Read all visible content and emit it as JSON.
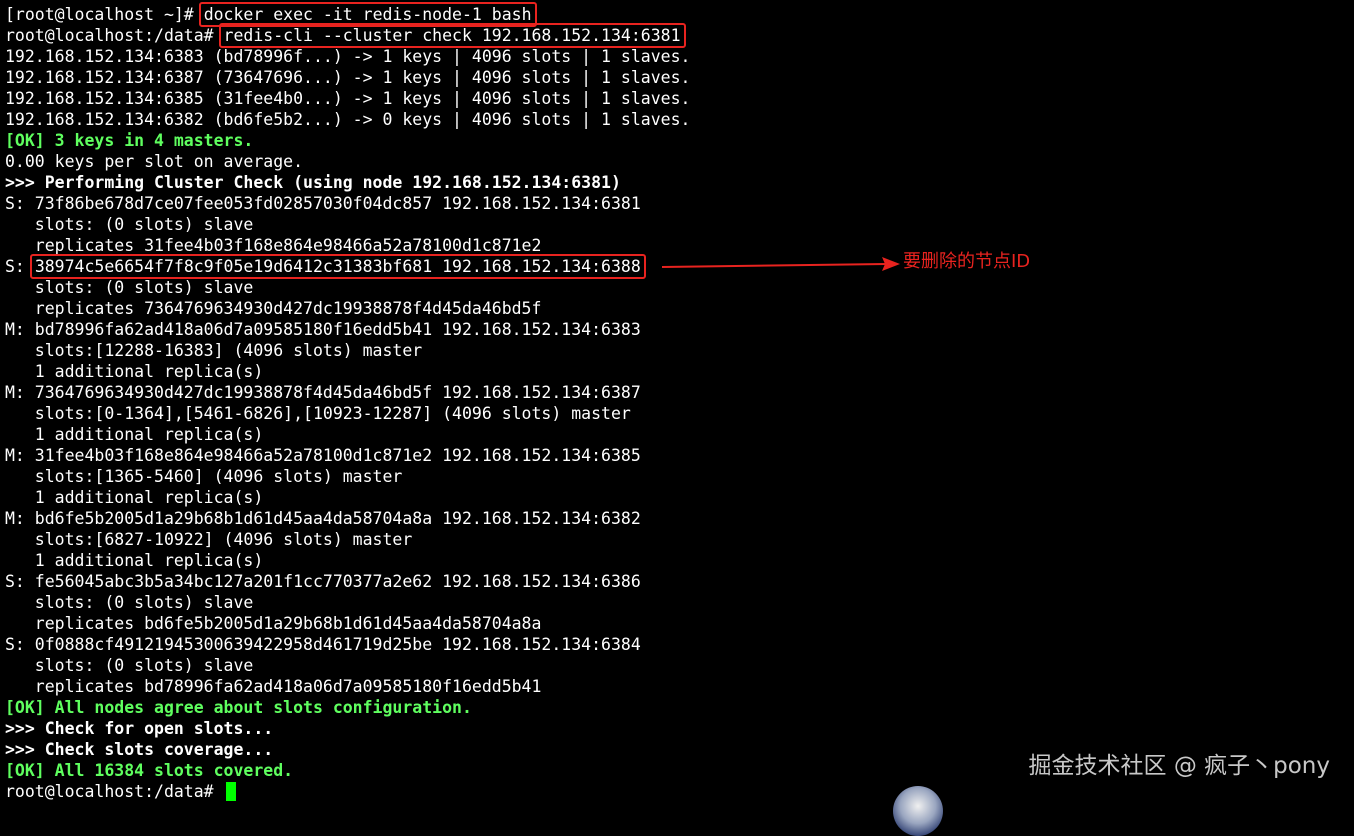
{
  "terminal": {
    "lines": [
      {
        "prompt": "[root@localhost ~]# ",
        "command": "docker exec -it redis-node-1 bash"
      },
      {
        "prompt": "root@localhost:/data# ",
        "command": "redis-cli --cluster check 192.168.152.134:6381"
      },
      {
        "text": "192.168.152.134:6383 (bd78996f...) -> 1 keys | 4096 slots | 1 slaves."
      },
      {
        "text": "192.168.152.134:6387 (73647696...) -> 1 keys | 4096 slots | 1 slaves."
      },
      {
        "text": "192.168.152.134:6385 (31fee4b0...) -> 1 keys | 4096 slots | 1 slaves."
      },
      {
        "text": "192.168.152.134:6382 (bd6fe5b2...) -> 0 keys | 4096 slots | 1 slaves."
      },
      {
        "text": "[OK] 3 keys in 4 masters."
      },
      {
        "text": "0.00 keys per slot on average."
      },
      {
        "text": ">>> Performing Cluster Check (using node 192.168.152.134:6381)"
      },
      {
        "text": "S: 73f86be678d7ce07fee053fd02857030f04dc857 192.168.152.134:6381"
      },
      {
        "text": "   slots: (0 slots) slave"
      },
      {
        "text": "   replicates 31fee4b03f168e864e98466a52a78100d1c871e2"
      },
      {
        "prefix": "S: ",
        "highlight": "38974c5e6654f7f8c9f05e19d6412c31383bf681 192.168.152.134:6388"
      },
      {
        "text": "   slots: (0 slots) slave"
      },
      {
        "text": "   replicates 7364769634930d427dc19938878f4d45da46bd5f"
      },
      {
        "text": "M: bd78996fa62ad418a06d7a09585180f16edd5b41 192.168.152.134:6383"
      },
      {
        "text": "   slots:[12288-16383] (4096 slots) master"
      },
      {
        "text": "   1 additional replica(s)"
      },
      {
        "text": "M: 7364769634930d427dc19938878f4d45da46bd5f 192.168.152.134:6387"
      },
      {
        "text": "   slots:[0-1364],[5461-6826],[10923-12287] (4096 slots) master"
      },
      {
        "text": "   1 additional replica(s)"
      },
      {
        "text": "M: 31fee4b03f168e864e98466a52a78100d1c871e2 192.168.152.134:6385"
      },
      {
        "text": "   slots:[1365-5460] (4096 slots) master"
      },
      {
        "text": "   1 additional replica(s)"
      },
      {
        "text": "M: bd6fe5b2005d1a29b68b1d61d45aa4da58704a8a 192.168.152.134:6382"
      },
      {
        "text": "   slots:[6827-10922] (4096 slots) master"
      },
      {
        "text": "   1 additional replica(s)"
      },
      {
        "text": "S: fe56045abc3b5a34bc127a201f1cc770377a2e62 192.168.152.134:6386"
      },
      {
        "text": "   slots: (0 slots) slave"
      },
      {
        "text": "   replicates bd6fe5b2005d1a29b68b1d61d45aa4da58704a8a"
      },
      {
        "text": "S: 0f0888cf49121945300639422958d461719d25be 192.168.152.134:6384"
      },
      {
        "text": "   slots: (0 slots) slave"
      },
      {
        "text": "   replicates bd78996fa62ad418a06d7a09585180f16edd5b41"
      },
      {
        "text": "[OK] All nodes agree about slots configuration."
      },
      {
        "text": ">>> Check for open slots..."
      },
      {
        "text": ">>> Check slots coverage..."
      },
      {
        "text": "[OK] All 16384 slots covered."
      }
    ],
    "final_prompt": "root@localhost:/data# "
  },
  "annotation": {
    "text": "要删除的节点ID",
    "color": "#e8231f"
  },
  "watermark": "掘金技术社区 @ 疯子丶pony",
  "colors": {
    "background": "#000000",
    "text": "#ffffff",
    "ok_green": "#5fff5f",
    "cursor": "#00ff00",
    "highlight_box": "#e8231f"
  }
}
